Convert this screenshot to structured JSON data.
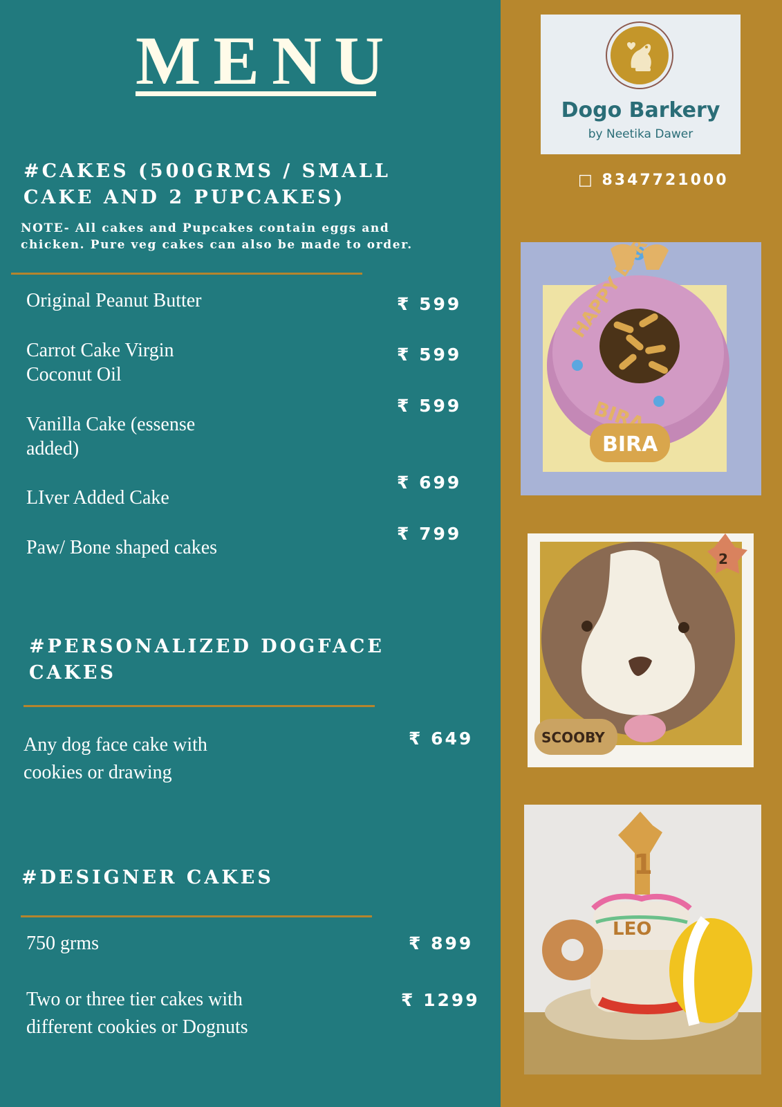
{
  "menu_title": "MENU",
  "cakes": {
    "title_line1": "#CAKES (500GRMS / SMALL",
    "title_line2": "CAKE AND 2 PUPCAKES)",
    "note_line1": "NOTE- All cakes and Pupcakes contain eggs and",
    "note_line2": "chicken. Pure veg cakes can also be made to order.",
    "items": [
      {
        "name": "Original Peanut Butter",
        "price": "₹ 599"
      },
      {
        "name": "Carrot Cake Virgin\n Coconut Oil",
        "price": "₹ 599"
      },
      {
        "name": "Vanilla Cake (essense\nadded)",
        "price": "₹ 599"
      },
      {
        "name": "LIver Added Cake",
        "price": "₹ 699"
      },
      {
        "name": "Paw/ Bone shaped cakes",
        "price": "₹ 799"
      }
    ]
  },
  "dogface": {
    "title_line1": "#PERSONALIZED DOGFACE",
    "title_line2": "CAKES",
    "items": [
      {
        "name": "Any dog face cake with\ncookies or drawing",
        "price": "₹ 649"
      }
    ]
  },
  "designer": {
    "title": "#DESIGNER CAKES",
    "items": [
      {
        "name": "750 grms",
        "price": "₹ 899"
      },
      {
        "name": "Two or three tier cakes with\ndifferent cookies or Dognuts",
        "price": "₹ 1299"
      }
    ]
  },
  "brand": {
    "name": "Dogo Barkery",
    "byline": "by Neetika Dawer",
    "phone_icon": "phone-icon",
    "phone": "8347721000"
  },
  "photos": {
    "photo1_text_a": "HAPPY BARKDAY",
    "photo1_text_b": "BIRA",
    "photo2_text": "SCOOBY",
    "photo2_tag": "2",
    "photo3_text": "LEO",
    "photo3_number": "1"
  },
  "colors": {
    "teal_panel": "#217a7e",
    "mustard_panel": "#b7872d",
    "rule": "#b5852d",
    "brand_text": "#2a6d77"
  }
}
